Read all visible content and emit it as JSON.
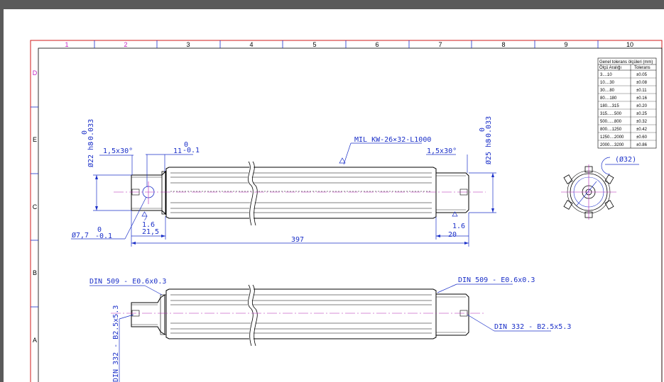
{
  "frame": {
    "columns": [
      "1",
      "2",
      "3",
      "4",
      "5",
      "6",
      "7",
      "8",
      "9",
      "10"
    ],
    "rows": [
      "D",
      "E",
      "C",
      "B",
      "A"
    ]
  },
  "tolerance_table": {
    "title": "Genel tolerans ölçüleri (mm)",
    "col_range": "Ölçü Aralığı",
    "col_tol": "Tolerans",
    "rows": [
      {
        "range": "3....10",
        "tol": "±0.05"
      },
      {
        "range": "10....30",
        "tol": "±0.08"
      },
      {
        "range": "30....80",
        "tol": "±0.11"
      },
      {
        "range": "80....180",
        "tol": "±0.16"
      },
      {
        "range": "180....315",
        "tol": "±0.20"
      },
      {
        "range": "315......500",
        "tol": "±0.25"
      },
      {
        "range": "500......800",
        "tol": "±0.32"
      },
      {
        "range": "800....1250",
        "tol": "±0.42"
      },
      {
        "range": "1250....2000",
        "tol": "±0.60"
      },
      {
        "range": "2000....3200",
        "tol": "±0.86"
      }
    ]
  },
  "annotations": {
    "dia22": "Ø22 h8",
    "dia22_tol_upper": "0",
    "dia22_tol_lower": "-0.033",
    "dia25": "Ø25 h8",
    "dia25_tol_upper": "0",
    "dia25_tol_lower": "-0.033",
    "chamfer_left": "1,5x30°",
    "chamfer_right": "1,5x30°",
    "len11": "11",
    "len11_tol_upper": "0",
    "len11_tol_lower": "-0.1",
    "mil": "MIL KW-26×32-L1000",
    "dia7": "Ø7,7",
    "dia7_tol_upper": "0",
    "dia7_tol_lower": "-0.1",
    "len21": "21,5",
    "rough_left": "1.6",
    "rough_right": "1.6",
    "len20": "20",
    "len397": "397",
    "dia32": "(Ø32)",
    "din509_left": "DIN 509 - E0.6x0.3",
    "din509_right": "DIN 509 - E0.6x0.3",
    "din332_right": "DIN 332 - B2.5x5.3",
    "din332_left": "DIN 332 - B2.5x5.3"
  },
  "colors": {
    "frame": "#d21b1b",
    "frame_labels": "#1a2fc8",
    "dimension": "#1a2fc8",
    "outline": "#000000",
    "centerline": "#b01ab0"
  }
}
